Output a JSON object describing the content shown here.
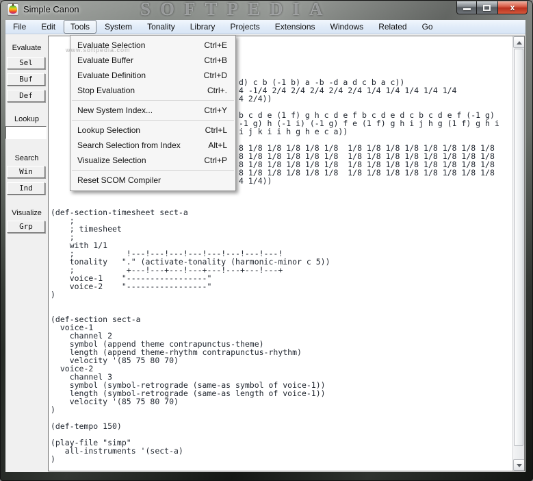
{
  "window": {
    "title": "Simple Canon",
    "watermark_big": "SOFTPEDIA",
    "watermark_small": "www.softpedia.com",
    "close_glyph": "x"
  },
  "menubar": {
    "items": [
      {
        "label": "File"
      },
      {
        "label": "Edit"
      },
      {
        "label": "Tools"
      },
      {
        "label": "System"
      },
      {
        "label": "Tonality"
      },
      {
        "label": "Library"
      },
      {
        "label": "Projects"
      },
      {
        "label": "Extensions"
      },
      {
        "label": "Windows"
      },
      {
        "label": "Related"
      },
      {
        "label": "Go"
      }
    ],
    "active_item": "Tools"
  },
  "tools_menu": {
    "items": [
      {
        "label": "Evaluate Selection",
        "shortcut": "Ctrl+E"
      },
      {
        "label": "Evaluate Buffer",
        "shortcut": "Ctrl+B"
      },
      {
        "label": "Evaluate Definition",
        "shortcut": "Ctrl+D"
      },
      {
        "label": "Stop Evaluation",
        "shortcut": "Ctrl+."
      },
      {
        "label": "New System Index...",
        "shortcut": "Ctrl+Y"
      },
      {
        "label": "Lookup Selection",
        "shortcut": "Ctrl+L"
      },
      {
        "label": "Search Selection from Index",
        "shortcut": "Alt+L"
      },
      {
        "label": "Visualize Selection",
        "shortcut": "Ctrl+P"
      },
      {
        "label": "Reset SCOM Compiler",
        "shortcut": ""
      }
    ]
  },
  "sidebar": {
    "groups": [
      {
        "label": "Evaluate",
        "buttons": [
          "Sel",
          "Buf",
          "Def"
        ]
      },
      {
        "label": "Lookup",
        "input_value": ""
      },
      {
        "label": "Search",
        "buttons": [
          "Win",
          "Ind"
        ]
      },
      {
        "label": "Visualize",
        "buttons": [
          "Grp"
        ]
      }
    ]
  },
  "editor": {
    "clipped_fragment_lines": [
      "d) c b (-1 b) a -b -d a d c b a c))",
      "4 -1/4 2/4 2/4 2/4 2/4 2/4 1/4 1/4 1/4 1/4 1/4",
      "4 2/4))",
      "",
      "b c d e (1 f) g h c d e f b c d e d c b c d e f (-1 g)",
      "-1 g) h (-1 i) (-1 g) f e (1 f) g h i j h g (1 f) g h i",
      "i j k i i h g h e c a))",
      "",
      "8 1/8 1/8 1/8 1/8 1/8  1/8 1/8 1/8 1/8 1/8 1/8 1/8 1/8",
      "8 1/8 1/8 1/8 1/8 1/8  1/8 1/8 1/8 1/8 1/8 1/8 1/8 1/8",
      "8 1/8 1/8 1/8 1/8 1/8  1/8 1/8 1/8 1/8 1/8 1/8 1/8 1/8",
      "8 1/8 1/8 1/8 1/8 1/8  1/8 1/8 1/8 1/8 1/8 1/8 1/8 1/8",
      "4 1/4))"
    ],
    "code_lines": [
      "(def-section-timesheet sect-a",
      "    ;",
      "    ; timesheet",
      "    ;",
      "    with 1/1",
      "    ;           !---!---!---!---!---!---!---!---!",
      "    tonality   \".\" (activate-tonality (harmonic-minor c 5))",
      "    ;           +---!---+---!---+---!---+---!---+",
      "    voice-1    \"-----------------\"",
      "    voice-2    \"-----------------\"",
      ")",
      "",
      "",
      "(def-section sect-a",
      "  voice-1",
      "    channel 2",
      "    symbol (append theme contrapunctus-theme)",
      "    length (append theme-rhythm contrapunctus-rhythm)",
      "    velocity '(85 75 80 70)",
      "  voice-2",
      "    channel 3",
      "    symbol (symbol-retrograde (same-as symbol of voice-1))",
      "    length (symbol-retrograde (same-as length of voice-1))",
      "    velocity '(85 75 80 70)",
      ")",
      "",
      "(def-tempo 150)",
      "",
      "(play-file \"simp\"",
      "   all-instruments '(sect-a)",
      ")"
    ]
  },
  "colors": {
    "titlebar_glass": "#565c56",
    "menubar_top": "#f2f7fd",
    "menubar_bottom": "#d8e5f5",
    "close_button_red": "#bb3220",
    "editor_text": "#20262f",
    "panel_gray": "#f0f0f0"
  }
}
